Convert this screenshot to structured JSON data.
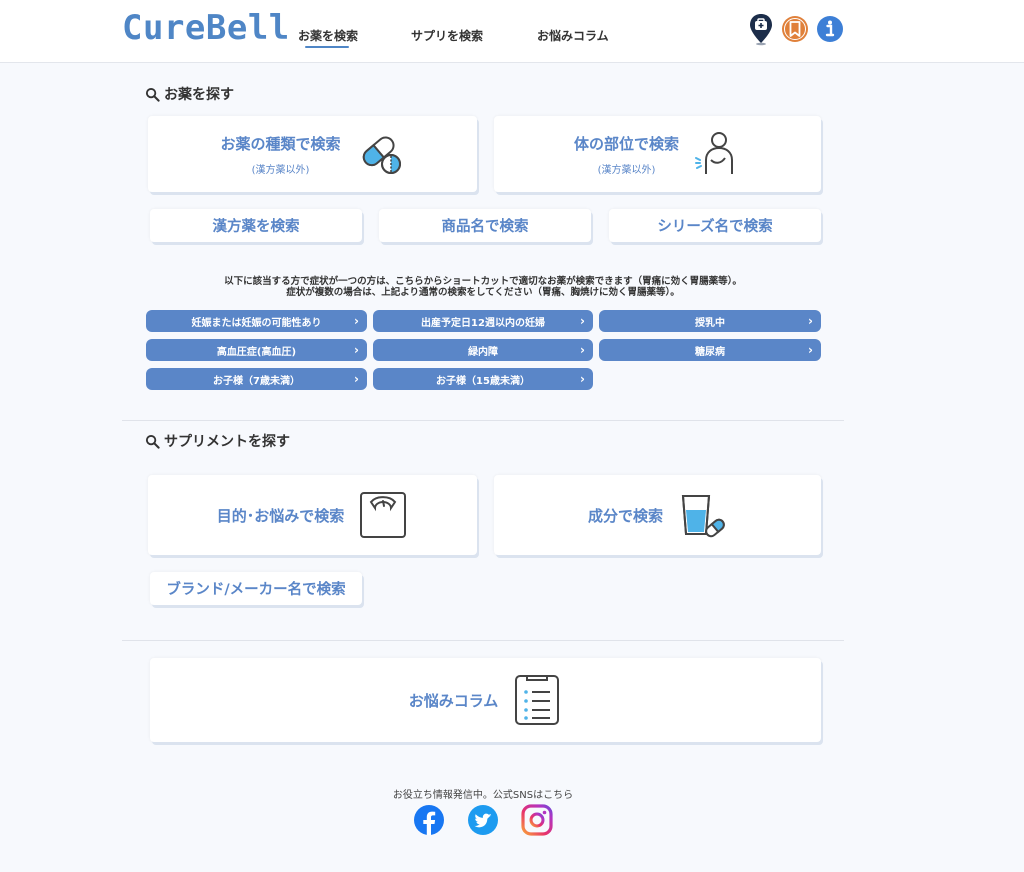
{
  "header": {
    "logo": "CureBell",
    "tabs": [
      {
        "label": "お薬を検索",
        "active": true
      },
      {
        "label": "サプリを検索",
        "active": false
      },
      {
        "label": "お悩みコラム",
        "active": false
      }
    ],
    "icons": [
      "map-pin-medical-icon",
      "bookmark-icon",
      "info-icon"
    ]
  },
  "medicine": {
    "title": "お薬を探す",
    "type_search": {
      "label": "お薬の種類で検索",
      "sub": "(漢方薬以外)"
    },
    "body_search": {
      "label": "体の部位で検索",
      "sub": "(漢方薬以外)"
    },
    "kampo_search": "漢方薬を検索",
    "product_search": "商品名で検索",
    "series_search": "シリーズ名で検索",
    "shortcut_line1": "以下に該当する方で症状が一つの方は、こちらからショートカットで適切なお薬が検索できます（胃痛に効く胃腸薬等）。",
    "shortcut_line2": "症状が複数の場合は、上記より通常の検索をしてください（胃痛、胸焼けに効く胃腸薬等）。",
    "shortcuts": [
      "妊娠または妊娠の可能性あり",
      "出産予定日12週以内の妊婦",
      "授乳中",
      "高血圧症(高血圧)",
      "緑内障",
      "糖尿病",
      "お子様（7歳未満）",
      "お子様（15歳未満）"
    ]
  },
  "supplement": {
    "title": "サプリメントを探す",
    "purpose_search": "目的･お悩みで検索",
    "ingredient_search": "成分で検索",
    "brand_search": "ブランド/メーカー名で検索"
  },
  "column": {
    "label": "お悩みコラム"
  },
  "footer": {
    "sns_text": "お役立ち情報発信中。公式SNSはこちら",
    "icons": [
      "facebook-icon",
      "twitter-icon",
      "instagram-icon"
    ]
  },
  "colors": {
    "accent": "#5a86c8",
    "logo": "#4f86c6",
    "bookmark": "#e0803a",
    "info": "#3d7fd6",
    "facebook": "#1877f2",
    "twitter": "#1d9bf0"
  }
}
